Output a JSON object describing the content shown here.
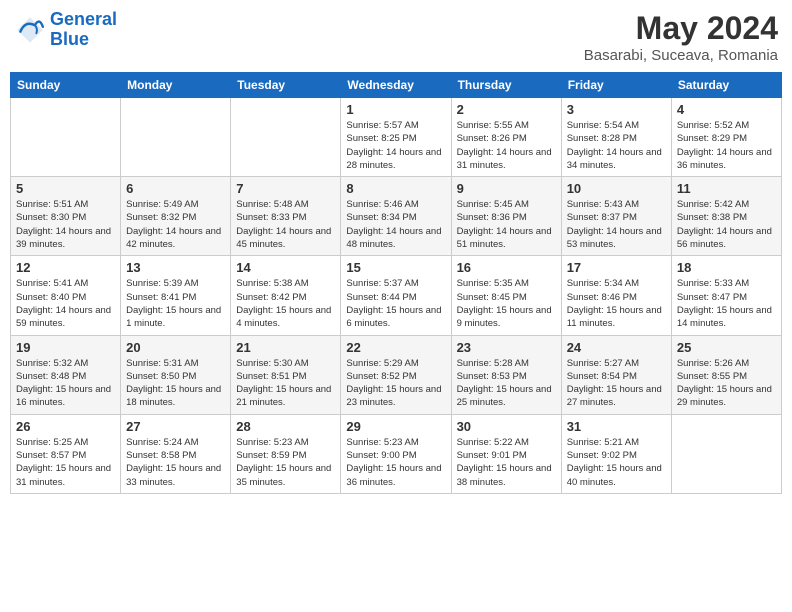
{
  "logo": {
    "line1": "General",
    "line2": "Blue"
  },
  "title": "May 2024",
  "location": "Basarabi, Suceava, Romania",
  "days_of_week": [
    "Sunday",
    "Monday",
    "Tuesday",
    "Wednesday",
    "Thursday",
    "Friday",
    "Saturday"
  ],
  "weeks": [
    [
      {
        "day": "",
        "info": ""
      },
      {
        "day": "",
        "info": ""
      },
      {
        "day": "",
        "info": ""
      },
      {
        "day": "1",
        "info": "Sunrise: 5:57 AM\nSunset: 8:25 PM\nDaylight: 14 hours\nand 28 minutes."
      },
      {
        "day": "2",
        "info": "Sunrise: 5:55 AM\nSunset: 8:26 PM\nDaylight: 14 hours\nand 31 minutes."
      },
      {
        "day": "3",
        "info": "Sunrise: 5:54 AM\nSunset: 8:28 PM\nDaylight: 14 hours\nand 34 minutes."
      },
      {
        "day": "4",
        "info": "Sunrise: 5:52 AM\nSunset: 8:29 PM\nDaylight: 14 hours\nand 36 minutes."
      }
    ],
    [
      {
        "day": "5",
        "info": "Sunrise: 5:51 AM\nSunset: 8:30 PM\nDaylight: 14 hours\nand 39 minutes."
      },
      {
        "day": "6",
        "info": "Sunrise: 5:49 AM\nSunset: 8:32 PM\nDaylight: 14 hours\nand 42 minutes."
      },
      {
        "day": "7",
        "info": "Sunrise: 5:48 AM\nSunset: 8:33 PM\nDaylight: 14 hours\nand 45 minutes."
      },
      {
        "day": "8",
        "info": "Sunrise: 5:46 AM\nSunset: 8:34 PM\nDaylight: 14 hours\nand 48 minutes."
      },
      {
        "day": "9",
        "info": "Sunrise: 5:45 AM\nSunset: 8:36 PM\nDaylight: 14 hours\nand 51 minutes."
      },
      {
        "day": "10",
        "info": "Sunrise: 5:43 AM\nSunset: 8:37 PM\nDaylight: 14 hours\nand 53 minutes."
      },
      {
        "day": "11",
        "info": "Sunrise: 5:42 AM\nSunset: 8:38 PM\nDaylight: 14 hours\nand 56 minutes."
      }
    ],
    [
      {
        "day": "12",
        "info": "Sunrise: 5:41 AM\nSunset: 8:40 PM\nDaylight: 14 hours\nand 59 minutes."
      },
      {
        "day": "13",
        "info": "Sunrise: 5:39 AM\nSunset: 8:41 PM\nDaylight: 15 hours\nand 1 minute."
      },
      {
        "day": "14",
        "info": "Sunrise: 5:38 AM\nSunset: 8:42 PM\nDaylight: 15 hours\nand 4 minutes."
      },
      {
        "day": "15",
        "info": "Sunrise: 5:37 AM\nSunset: 8:44 PM\nDaylight: 15 hours\nand 6 minutes."
      },
      {
        "day": "16",
        "info": "Sunrise: 5:35 AM\nSunset: 8:45 PM\nDaylight: 15 hours\nand 9 minutes."
      },
      {
        "day": "17",
        "info": "Sunrise: 5:34 AM\nSunset: 8:46 PM\nDaylight: 15 hours\nand 11 minutes."
      },
      {
        "day": "18",
        "info": "Sunrise: 5:33 AM\nSunset: 8:47 PM\nDaylight: 15 hours\nand 14 minutes."
      }
    ],
    [
      {
        "day": "19",
        "info": "Sunrise: 5:32 AM\nSunset: 8:48 PM\nDaylight: 15 hours\nand 16 minutes."
      },
      {
        "day": "20",
        "info": "Sunrise: 5:31 AM\nSunset: 8:50 PM\nDaylight: 15 hours\nand 18 minutes."
      },
      {
        "day": "21",
        "info": "Sunrise: 5:30 AM\nSunset: 8:51 PM\nDaylight: 15 hours\nand 21 minutes."
      },
      {
        "day": "22",
        "info": "Sunrise: 5:29 AM\nSunset: 8:52 PM\nDaylight: 15 hours\nand 23 minutes."
      },
      {
        "day": "23",
        "info": "Sunrise: 5:28 AM\nSunset: 8:53 PM\nDaylight: 15 hours\nand 25 minutes."
      },
      {
        "day": "24",
        "info": "Sunrise: 5:27 AM\nSunset: 8:54 PM\nDaylight: 15 hours\nand 27 minutes."
      },
      {
        "day": "25",
        "info": "Sunrise: 5:26 AM\nSunset: 8:55 PM\nDaylight: 15 hours\nand 29 minutes."
      }
    ],
    [
      {
        "day": "26",
        "info": "Sunrise: 5:25 AM\nSunset: 8:57 PM\nDaylight: 15 hours\nand 31 minutes."
      },
      {
        "day": "27",
        "info": "Sunrise: 5:24 AM\nSunset: 8:58 PM\nDaylight: 15 hours\nand 33 minutes."
      },
      {
        "day": "28",
        "info": "Sunrise: 5:23 AM\nSunset: 8:59 PM\nDaylight: 15 hours\nand 35 minutes."
      },
      {
        "day": "29",
        "info": "Sunrise: 5:23 AM\nSunset: 9:00 PM\nDaylight: 15 hours\nand 36 minutes."
      },
      {
        "day": "30",
        "info": "Sunrise: 5:22 AM\nSunset: 9:01 PM\nDaylight: 15 hours\nand 38 minutes."
      },
      {
        "day": "31",
        "info": "Sunrise: 5:21 AM\nSunset: 9:02 PM\nDaylight: 15 hours\nand 40 minutes."
      },
      {
        "day": "",
        "info": ""
      }
    ]
  ]
}
